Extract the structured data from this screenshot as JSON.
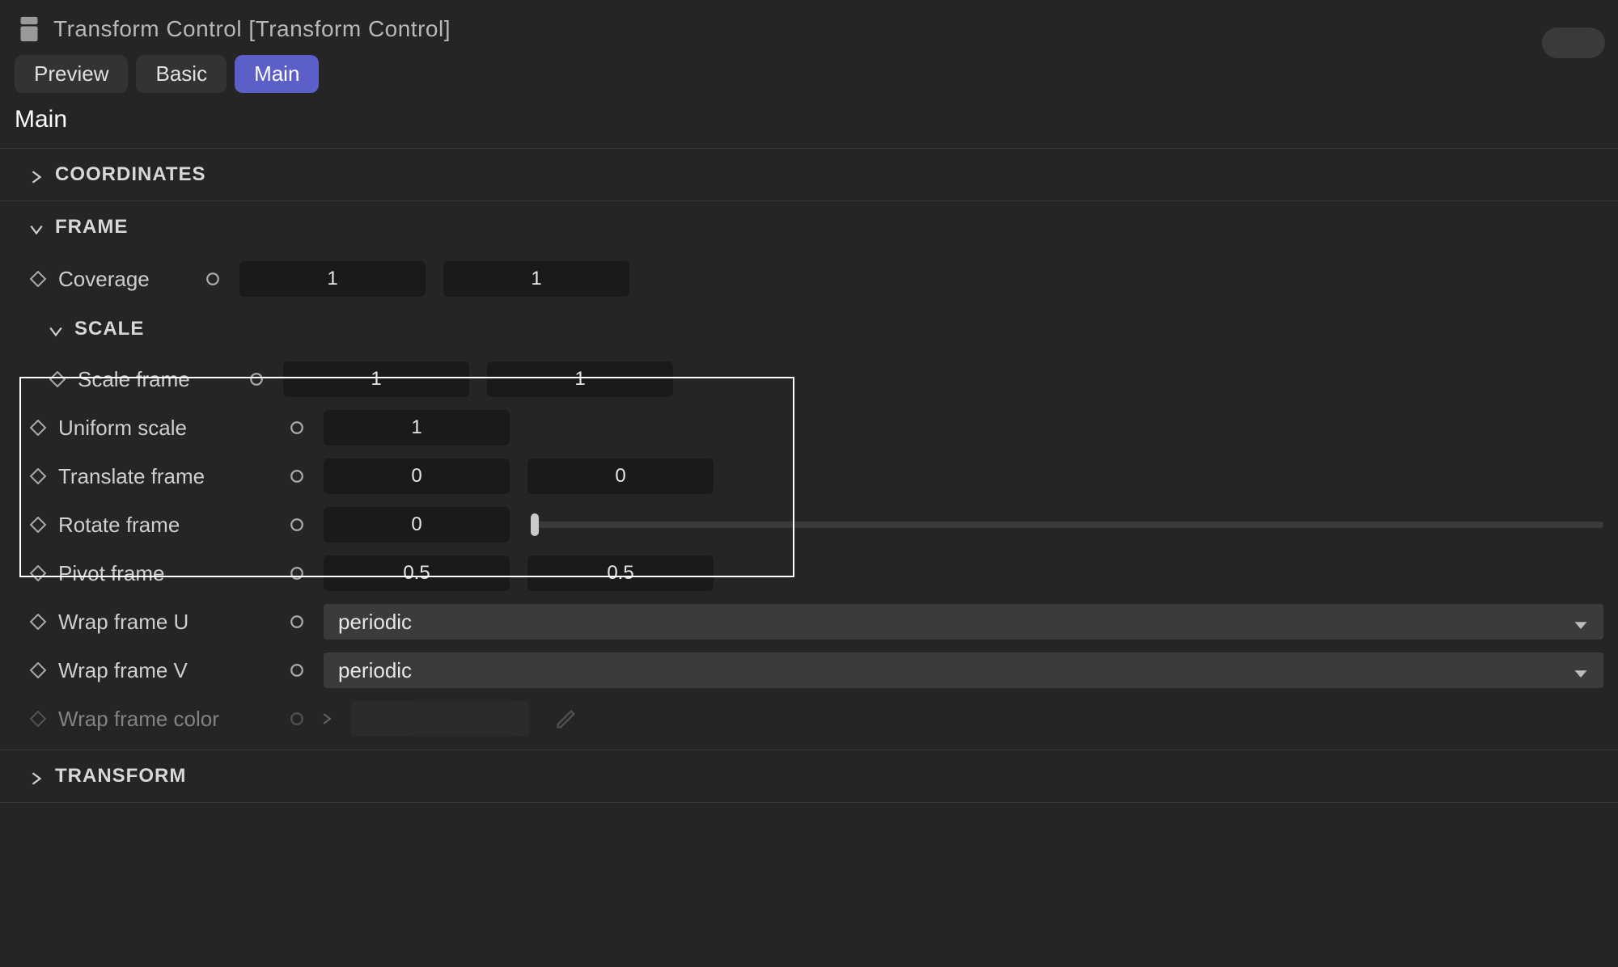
{
  "header": {
    "title": "Transform Control [Transform Control]"
  },
  "tabs": {
    "preview": "Preview",
    "basic": "Basic",
    "main": "Main"
  },
  "page_title": "Main",
  "groups": {
    "coordinates": {
      "label": "COORDINATES",
      "expanded": false
    },
    "frame": {
      "label": "FRAME",
      "expanded": true,
      "coverage": {
        "label": "Coverage",
        "v1": "1",
        "v2": "1"
      },
      "scale": {
        "label": "SCALE",
        "expanded": true,
        "scale_frame": {
          "label": "Scale frame",
          "v1": "1",
          "v2": "1"
        },
        "uniform_scale": {
          "label": "Uniform scale",
          "v": "1"
        },
        "translate_frame": {
          "label": "Translate frame",
          "v1": "0",
          "v2": "0"
        },
        "rotate_frame": {
          "label": "Rotate frame",
          "v": "0"
        },
        "pivot_frame": {
          "label": "Pivot frame",
          "v1": "0.5",
          "v2": "0.5"
        },
        "wrap_frame_u": {
          "label": "Wrap frame U",
          "value": "periodic"
        },
        "wrap_frame_v": {
          "label": "Wrap frame V",
          "value": "periodic"
        },
        "wrap_frame_color": {
          "label": "Wrap frame color"
        }
      }
    },
    "transform": {
      "label": "TRANSFORM",
      "expanded": false
    }
  },
  "colors": {
    "accent": "#5b5fc7",
    "bg": "#252525",
    "input_bg": "#1a1a1a",
    "dropdown_bg": "#3b3b3b"
  }
}
